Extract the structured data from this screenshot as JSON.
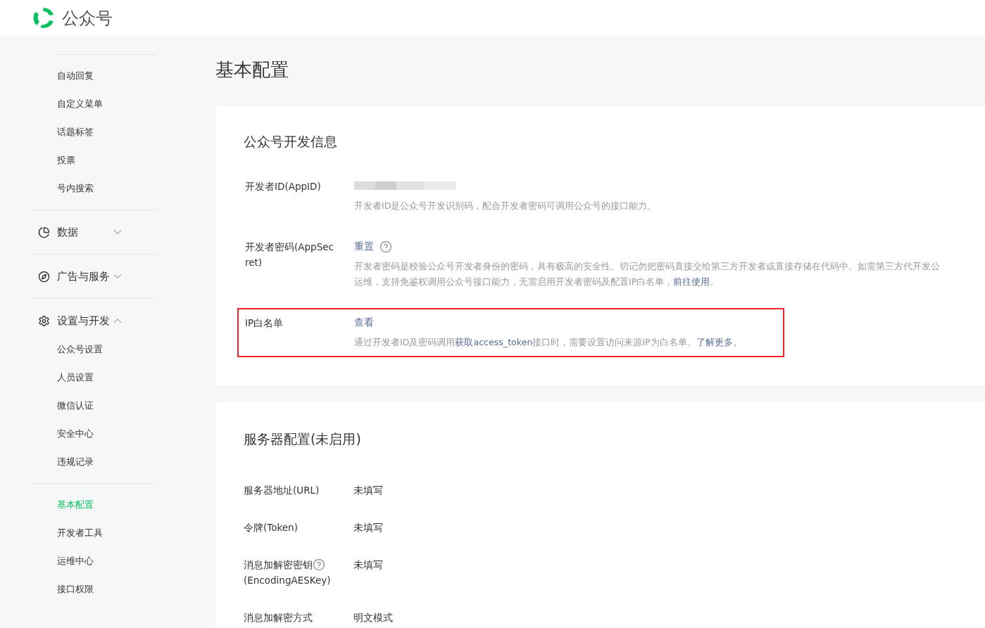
{
  "header": {
    "brand": "公众号"
  },
  "sidebar": {
    "sections": [
      {
        "kind": "list",
        "items": [
          {
            "label": "自动回复",
            "selected": false
          },
          {
            "label": "自定义菜单",
            "selected": false
          },
          {
            "label": "话题标签",
            "selected": false
          },
          {
            "label": "投票",
            "selected": false
          },
          {
            "label": "号内搜索",
            "selected": false
          }
        ]
      },
      {
        "kind": "group",
        "label": "数据",
        "expanded": false
      },
      {
        "kind": "group",
        "label": "广告与服务",
        "expanded": false
      },
      {
        "kind": "group",
        "label": "设置与开发",
        "expanded": true,
        "items": [
          {
            "label": "公众号设置",
            "selected": false
          },
          {
            "label": "人员设置",
            "selected": false
          },
          {
            "label": "微信认证",
            "selected": false
          },
          {
            "label": "安全中心",
            "selected": false
          },
          {
            "label": "违规记录",
            "selected": false
          }
        ]
      },
      {
        "kind": "list",
        "items": [
          {
            "label": "基本配置",
            "selected": true
          },
          {
            "label": "开发者工具",
            "selected": false
          },
          {
            "label": "运维中心",
            "selected": false
          },
          {
            "label": "接口权限",
            "selected": false
          }
        ]
      }
    ]
  },
  "page_title": "基本配置",
  "dev_info": {
    "title": "公众号开发信息",
    "rows": [
      {
        "label": "开发者ID(AppID)",
        "kind": "masked",
        "note_lines": [
          "开发者ID是公众号开发识别码，配合开发者密码可调用公众号的接口能力。"
        ]
      },
      {
        "label": "开发者密码(AppSec ret)",
        "kind": "action",
        "action": "重置",
        "help": true,
        "note_lines": [
          "开发者密码是校验公众号开发者身份的密码，具有极高的安全性。切记勿把密码直接交给第三方开发者或直接存储在代码中。如需第三方代开发公",
          "运维，支持免鉴权调用公众号接口能力，无需启用开发者密码及配置IP白名单，**前往使用**。"
        ]
      },
      {
        "label": "IP白名单",
        "kind": "action",
        "action": "查看",
        "help": false,
        "highlighted": true,
        "note_lines": [
          "通过开发者ID及密码调用**获取access_token**接口时，需要设置访问来源IP为白名单。**了解更多。**"
        ]
      }
    ]
  },
  "server_config": {
    "title": "服务器配置(未启用)",
    "rows": [
      {
        "label": "服务器地址(URL)",
        "help": false,
        "value": "未填写"
      },
      {
        "label": "令牌(Token)",
        "help": false,
        "value": "未填写"
      },
      {
        "label": "消息加解密密钥",
        "label_2": "(EncodingAESKey)",
        "help": true,
        "value": "未填写"
      },
      {
        "label": "消息加解密方式",
        "help": false,
        "value": "明文模式"
      }
    ]
  }
}
